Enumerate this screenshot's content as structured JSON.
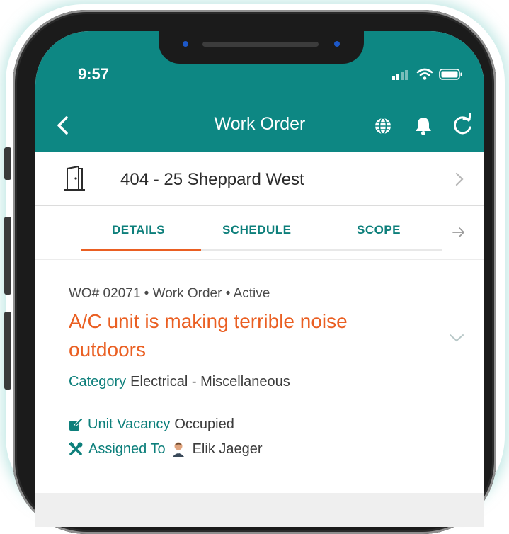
{
  "colors": {
    "header": "#0d8783",
    "accent": "#ea5f22",
    "teal_text": "#0d7f7b"
  },
  "status_bar": {
    "time": "9:57"
  },
  "header": {
    "title": "Work Order",
    "icons": [
      "chevron-left-icon",
      "globe-icon",
      "bell-icon",
      "refresh-icon"
    ]
  },
  "location": {
    "label": "404 - 25 Sheppard West",
    "icon": "building-door-icon"
  },
  "tabs": [
    {
      "label": "DETAILS",
      "active": true
    },
    {
      "label": "SCHEDULE",
      "active": false
    },
    {
      "label": "SCOPE",
      "active": false
    }
  ],
  "work_order": {
    "meta": "WO# 02071 • Work Order • Active",
    "title": "A/C unit is making terrible noise outdoors",
    "category_label": "Category",
    "category_value": "Electrical - Miscellaneous",
    "vacancy_label": "Unit Vacancy",
    "vacancy_value": "Occupied",
    "assigned_label": "Assigned To",
    "assigned_value": "Elik Jaeger"
  }
}
